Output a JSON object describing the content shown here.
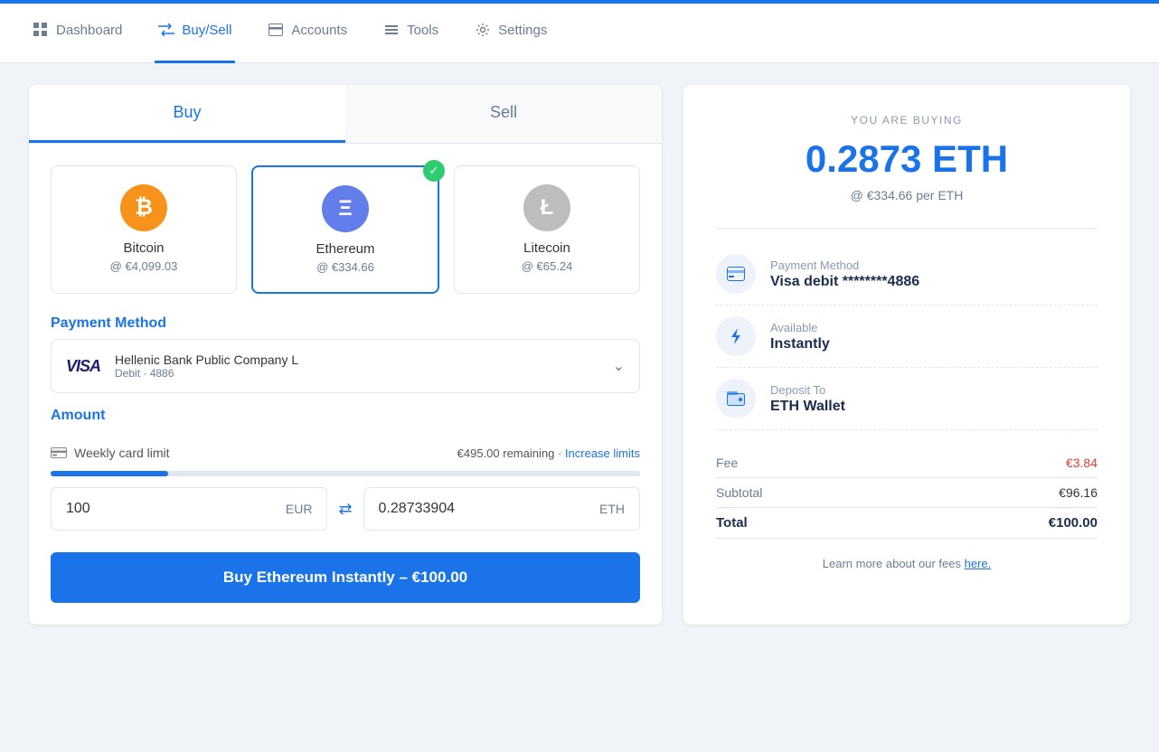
{
  "nav": {
    "items": [
      {
        "id": "dashboard",
        "label": "Dashboard",
        "icon": "grid",
        "active": false
      },
      {
        "id": "buysell",
        "label": "Buy/Sell",
        "icon": "exchange",
        "active": true
      },
      {
        "id": "accounts",
        "label": "Accounts",
        "icon": "card",
        "active": false
      },
      {
        "id": "tools",
        "label": "Tools",
        "icon": "tools",
        "active": false
      },
      {
        "id": "settings",
        "label": "Settings",
        "icon": "gear",
        "active": false
      }
    ]
  },
  "tabs": [
    {
      "id": "buy",
      "label": "Buy",
      "active": true
    },
    {
      "id": "sell",
      "label": "Sell",
      "active": false
    }
  ],
  "cryptos": [
    {
      "id": "bitcoin",
      "symbol": "BTC",
      "name": "Bitcoin",
      "price": "@ €4,099.03",
      "icon": "₿",
      "selected": false
    },
    {
      "id": "ethereum",
      "symbol": "ETH",
      "name": "Ethereum",
      "price": "@ €334.66",
      "icon": "Ξ",
      "selected": true
    },
    {
      "id": "litecoin",
      "symbol": "LTC",
      "name": "Litecoin",
      "price": "@ €65.24",
      "icon": "Ł",
      "selected": false
    }
  ],
  "payment": {
    "section_label": "Payment Method",
    "bank_name": "Hellenic Bank Public Company L",
    "card_type": "Debit · 4886",
    "visa_label": "VISA"
  },
  "amount": {
    "section_label": "Amount",
    "limit_label": "Weekly card limit",
    "remaining": "€495.00 remaining",
    "dot": "·",
    "increase_label": "Increase limits",
    "progress_percent": 20,
    "eur_value": "100",
    "eth_value": "0.28733904",
    "eur_currency": "EUR",
    "eth_currency": "ETH"
  },
  "buy_button": {
    "label": "Buy Ethereum Instantly – €100.00"
  },
  "summary": {
    "you_are_buying": "YOU ARE BUYING",
    "amount": "0.2873 ETH",
    "rate": "@ €334.66 per ETH",
    "payment_method": {
      "label": "Payment Method",
      "value": "Visa debit ********4886"
    },
    "available": {
      "label": "Available",
      "value": "Instantly"
    },
    "deposit_to": {
      "label": "Deposit To",
      "value": "ETH Wallet"
    },
    "fee_label": "Fee",
    "fee_value": "€3.84",
    "subtotal_label": "Subtotal",
    "subtotal_value": "€96.16",
    "total_label": "Total",
    "total_value": "€100.00",
    "learn_more": "Learn more about our fees ",
    "here": "here."
  }
}
